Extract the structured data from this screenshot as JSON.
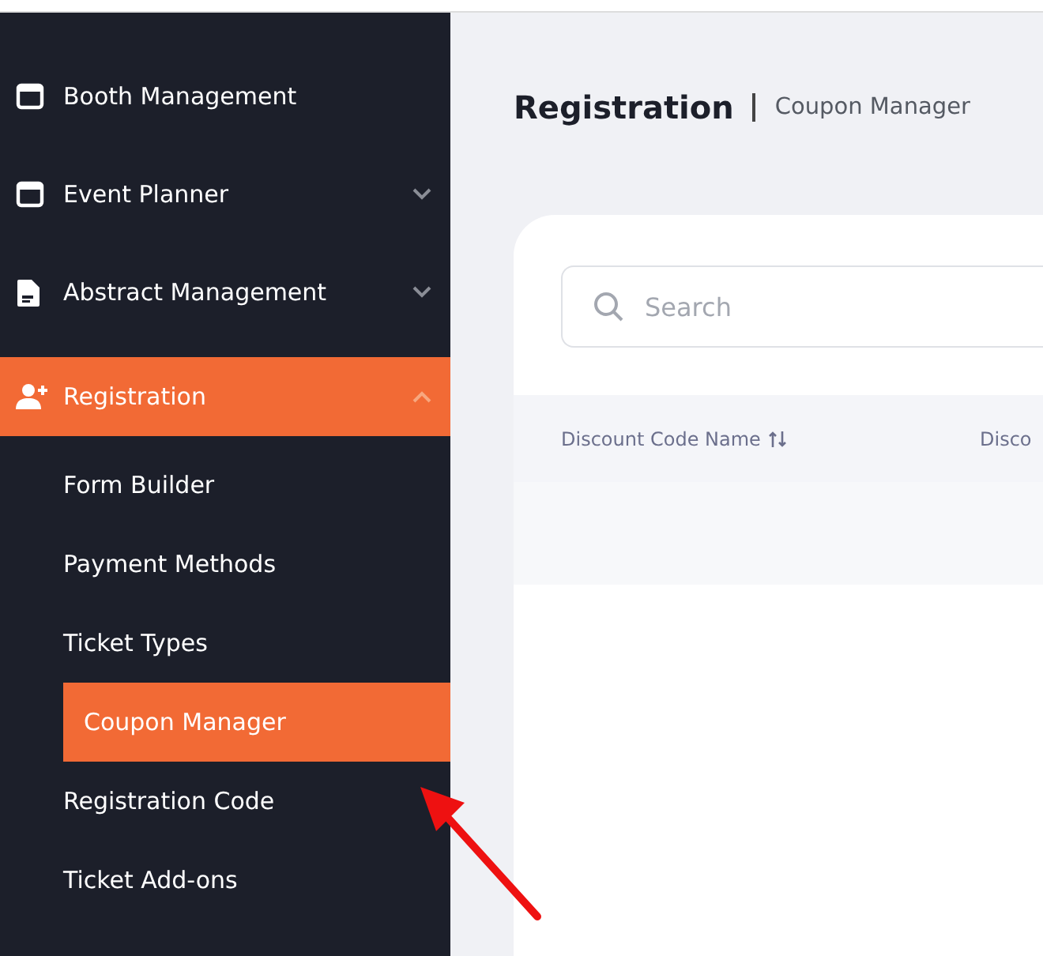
{
  "sidebar": {
    "items": [
      {
        "label": "Booth Management",
        "kind": "link",
        "selected": false
      },
      {
        "label": "Event Planner",
        "kind": "group",
        "expanded": false,
        "selected": false
      },
      {
        "label": "Abstract Management",
        "kind": "group",
        "expanded": false,
        "selected": false
      },
      {
        "label": "Registration",
        "kind": "group",
        "expanded": true,
        "selected": true,
        "children": [
          {
            "label": "Form Builder",
            "selected": false
          },
          {
            "label": "Payment Methods",
            "selected": false
          },
          {
            "label": "Ticket Types",
            "selected": false
          },
          {
            "label": "Coupon Manager",
            "selected": true
          },
          {
            "label": "Registration Code",
            "selected": false
          },
          {
            "label": "Ticket Add-ons",
            "selected": false
          }
        ]
      }
    ]
  },
  "header": {
    "title": "Registration",
    "subtitle": "Coupon Manager"
  },
  "search": {
    "placeholder": "Search"
  },
  "table": {
    "columns": [
      {
        "label": "Discount Code Name",
        "sortable": true
      },
      {
        "label": "Disco",
        "sortable": false
      }
    ]
  }
}
